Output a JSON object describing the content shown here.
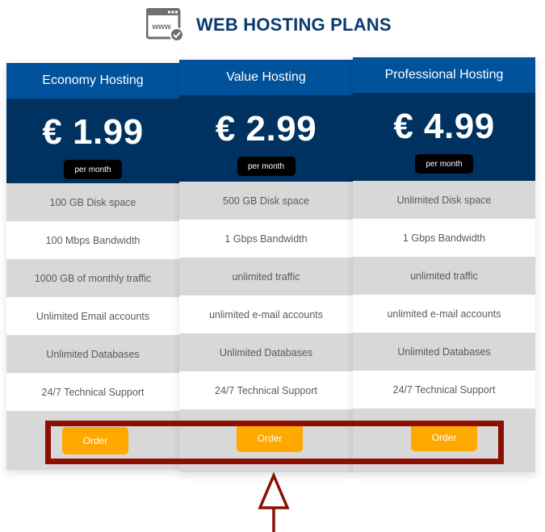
{
  "header": {
    "title": "WEB HOSTING PLANS",
    "icon": "www-browser-check-icon",
    "icon_text": "www"
  },
  "colors": {
    "title": "#0a3a6e",
    "plan_header_bg": "#00529b",
    "price_bg": "#003261",
    "period_badge_bg": "#000000",
    "row_gray": "#d8d8d8",
    "row_white": "#ffffff",
    "order_button": "#ffa800",
    "annotation": "#8b1000"
  },
  "plans": [
    {
      "name": "Economy Hosting",
      "price": "€ 1.99",
      "period": "per month",
      "features": [
        "100 GB Disk space",
        "100 Mbps Bandwidth",
        "1000 GB of monthly traffic",
        "Unlimited Email accounts",
        "Unlimited Databases",
        "24/7 Technical Support"
      ],
      "button_label": "Order"
    },
    {
      "name": "Value Hosting",
      "price": "€ 2.99",
      "period": "per month",
      "features": [
        "500 GB Disk space",
        "1 Gbps Bandwidth",
        "unlimited traffic",
        "unlimited e-mail accounts",
        "Unlimited Databases",
        "24/7 Technical Support"
      ],
      "button_label": "Order"
    },
    {
      "name": "Professional Hosting",
      "price": "€ 4.99",
      "period": "per month",
      "features": [
        "Unlimited Disk space",
        "1 Gbps Bandwidth",
        "unlimited traffic",
        "unlimited e-mail accounts",
        "Unlimited Databases",
        "24/7 Technical Support"
      ],
      "button_label": "Order"
    }
  ],
  "annotation": {
    "type": "highlight-box-with-up-arrow",
    "target": "order-buttons-row"
  }
}
